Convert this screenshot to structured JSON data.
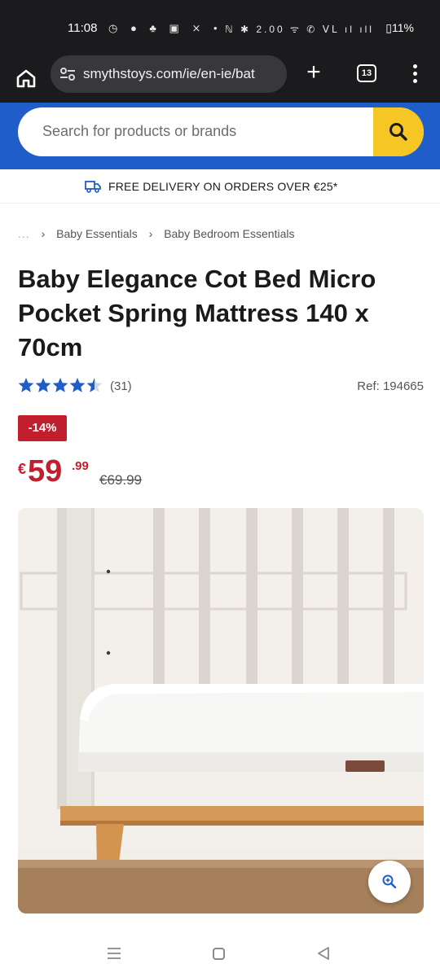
{
  "status_bar": {
    "time": "11:08",
    "left_icons": "◷ ● ♣ ▣ ⨯ •",
    "right_icons": "ℕ ✱ 2.00 ᯤ ✆ ⅤⅬ ıl ıll",
    "battery": "11%"
  },
  "browser": {
    "url": "smythstoys.com/ie/en-ie/bat",
    "tab_count": "13"
  },
  "header": {
    "search_placeholder": "Search for products or brands",
    "accent_color": "#1f5ec9",
    "search_button_color": "#f6c624"
  },
  "delivery_banner": {
    "text": "FREE DELIVERY ON ORDERS OVER €25*"
  },
  "breadcrumb": {
    "ellipsis": "...",
    "items": [
      "Baby Essentials",
      "Baby Bedroom Essentials"
    ]
  },
  "product": {
    "title": "Baby Elegance Cot Bed Micro Pocket Spring Mattress 140 x 70cm",
    "rating": 4.5,
    "review_count": "(31)",
    "ref": "Ref: 194665",
    "discount": "-14%",
    "price_currency": "€",
    "price_main": "59",
    "price_cents": ".99",
    "price_old": "€69.99",
    "sale_color": "#c21f2e"
  },
  "icons": {
    "home": "home-icon",
    "tune": "tune-icon",
    "plus": "plus-icon",
    "tabs": "tabs-icon",
    "menu": "more-vert-icon",
    "search": "search-icon",
    "delivery": "truck-icon",
    "zoom": "zoom-in-icon"
  }
}
